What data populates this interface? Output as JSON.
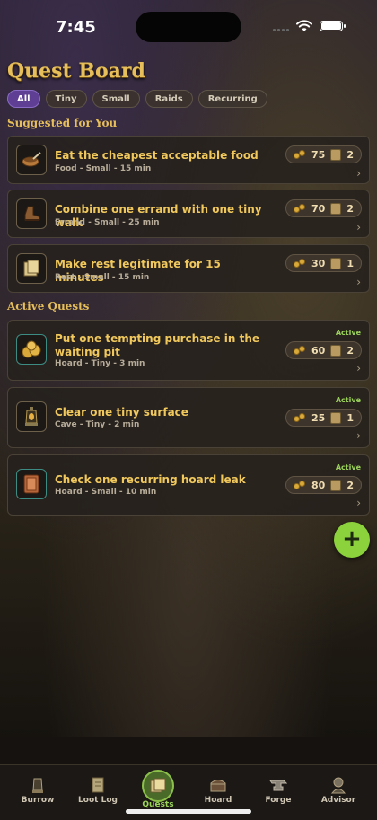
{
  "status": {
    "time": "7:45"
  },
  "page": {
    "title": "Quest Board"
  },
  "filters": [
    {
      "label": "All",
      "active": true
    },
    {
      "label": "Tiny",
      "active": false
    },
    {
      "label": "Small",
      "active": false
    },
    {
      "label": "Raids",
      "active": false
    },
    {
      "label": "Recurring",
      "active": false
    }
  ],
  "sections": {
    "suggested": "Suggested for You",
    "active": "Active Quests"
  },
  "suggested": [
    {
      "title": "Eat the cheapest acceptable food",
      "meta": "Food - Small - 15 min",
      "coins": "75",
      "scrolls": "2",
      "icon": "food-bowl-icon"
    },
    {
      "title": "Combine one errand with one tiny walk",
      "meta": "Errand - Small - 25 min",
      "coins": "70",
      "scrolls": "2",
      "icon": "boot-icon"
    },
    {
      "title": "Make rest legitimate for 15 minutes",
      "meta": "Rest - Small - 15 min",
      "coins": "30",
      "scrolls": "1",
      "icon": "scroll-map-icon"
    }
  ],
  "active": [
    {
      "title": "Put one tempting purchase in the waiting pit",
      "meta": "Hoard - Tiny - 3 min",
      "coins": "60",
      "scrolls": "2",
      "badge": "Active",
      "icon": "coin-pile-icon"
    },
    {
      "title": "Clear one tiny surface",
      "meta": "Cave - Tiny - 2 min",
      "coins": "25",
      "scrolls": "1",
      "badge": "Active",
      "icon": "lantern-icon"
    },
    {
      "title": "Check one recurring hoard leak",
      "meta": "Hoard - Small - 10 min",
      "coins": "80",
      "scrolls": "2",
      "badge": "Active",
      "icon": "tome-icon"
    }
  ],
  "fab": {
    "label": "+"
  },
  "tabs": [
    {
      "label": "Burrow",
      "icon": "lantern-icon",
      "active": false
    },
    {
      "label": "Loot Log",
      "icon": "scroll-icon",
      "active": false
    },
    {
      "label": "Quests",
      "icon": "quest-map-icon",
      "active": true
    },
    {
      "label": "Hoard",
      "icon": "chest-icon",
      "active": false
    },
    {
      "label": "Forge",
      "icon": "anvil-icon",
      "active": false
    },
    {
      "label": "Advisor",
      "icon": "goblin-advisor-icon",
      "active": false
    }
  ],
  "colors": {
    "accent_gold": "#e6be5a",
    "active_green": "#9bd35a",
    "chip_purple": "#5f3f93",
    "fab_green": "#8cd23c"
  }
}
